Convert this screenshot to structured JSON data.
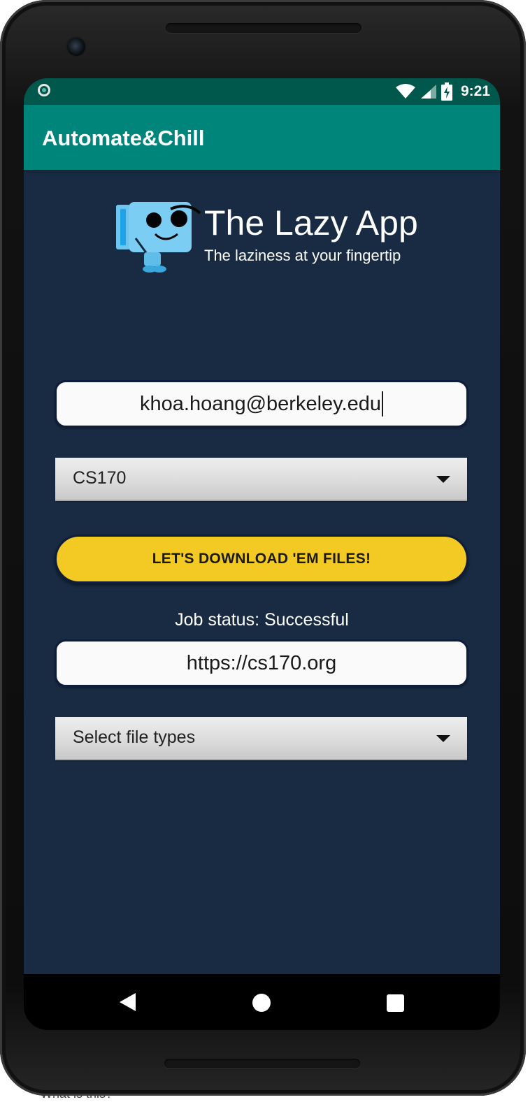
{
  "status_bar": {
    "time": "9:21",
    "icons": [
      "notification-dot-icon",
      "wifi-icon",
      "cell-signal-icon",
      "battery-charging-icon"
    ]
  },
  "app_bar": {
    "title": "Automate&Chill",
    "color": "#00857a"
  },
  "logo": {
    "title": "The Lazy App",
    "subtitle": "The laziness at your fingertip"
  },
  "form": {
    "email_value": "khoa.hoang@berkeley.edu",
    "course_selected": "CS170",
    "download_button_label": "LET'S DOWNLOAD 'EM FILES!",
    "job_status": "Job status: Successful",
    "url_value": "https://cs170.org",
    "file_types_selected": "Select file types"
  },
  "nav_bar": {
    "buttons": [
      "back-icon",
      "home-icon",
      "recents-icon"
    ]
  },
  "caption": "What is this?",
  "colors": {
    "background": "#182b42",
    "status_bar": "#00574b",
    "accent_button": "#f3c923"
  }
}
